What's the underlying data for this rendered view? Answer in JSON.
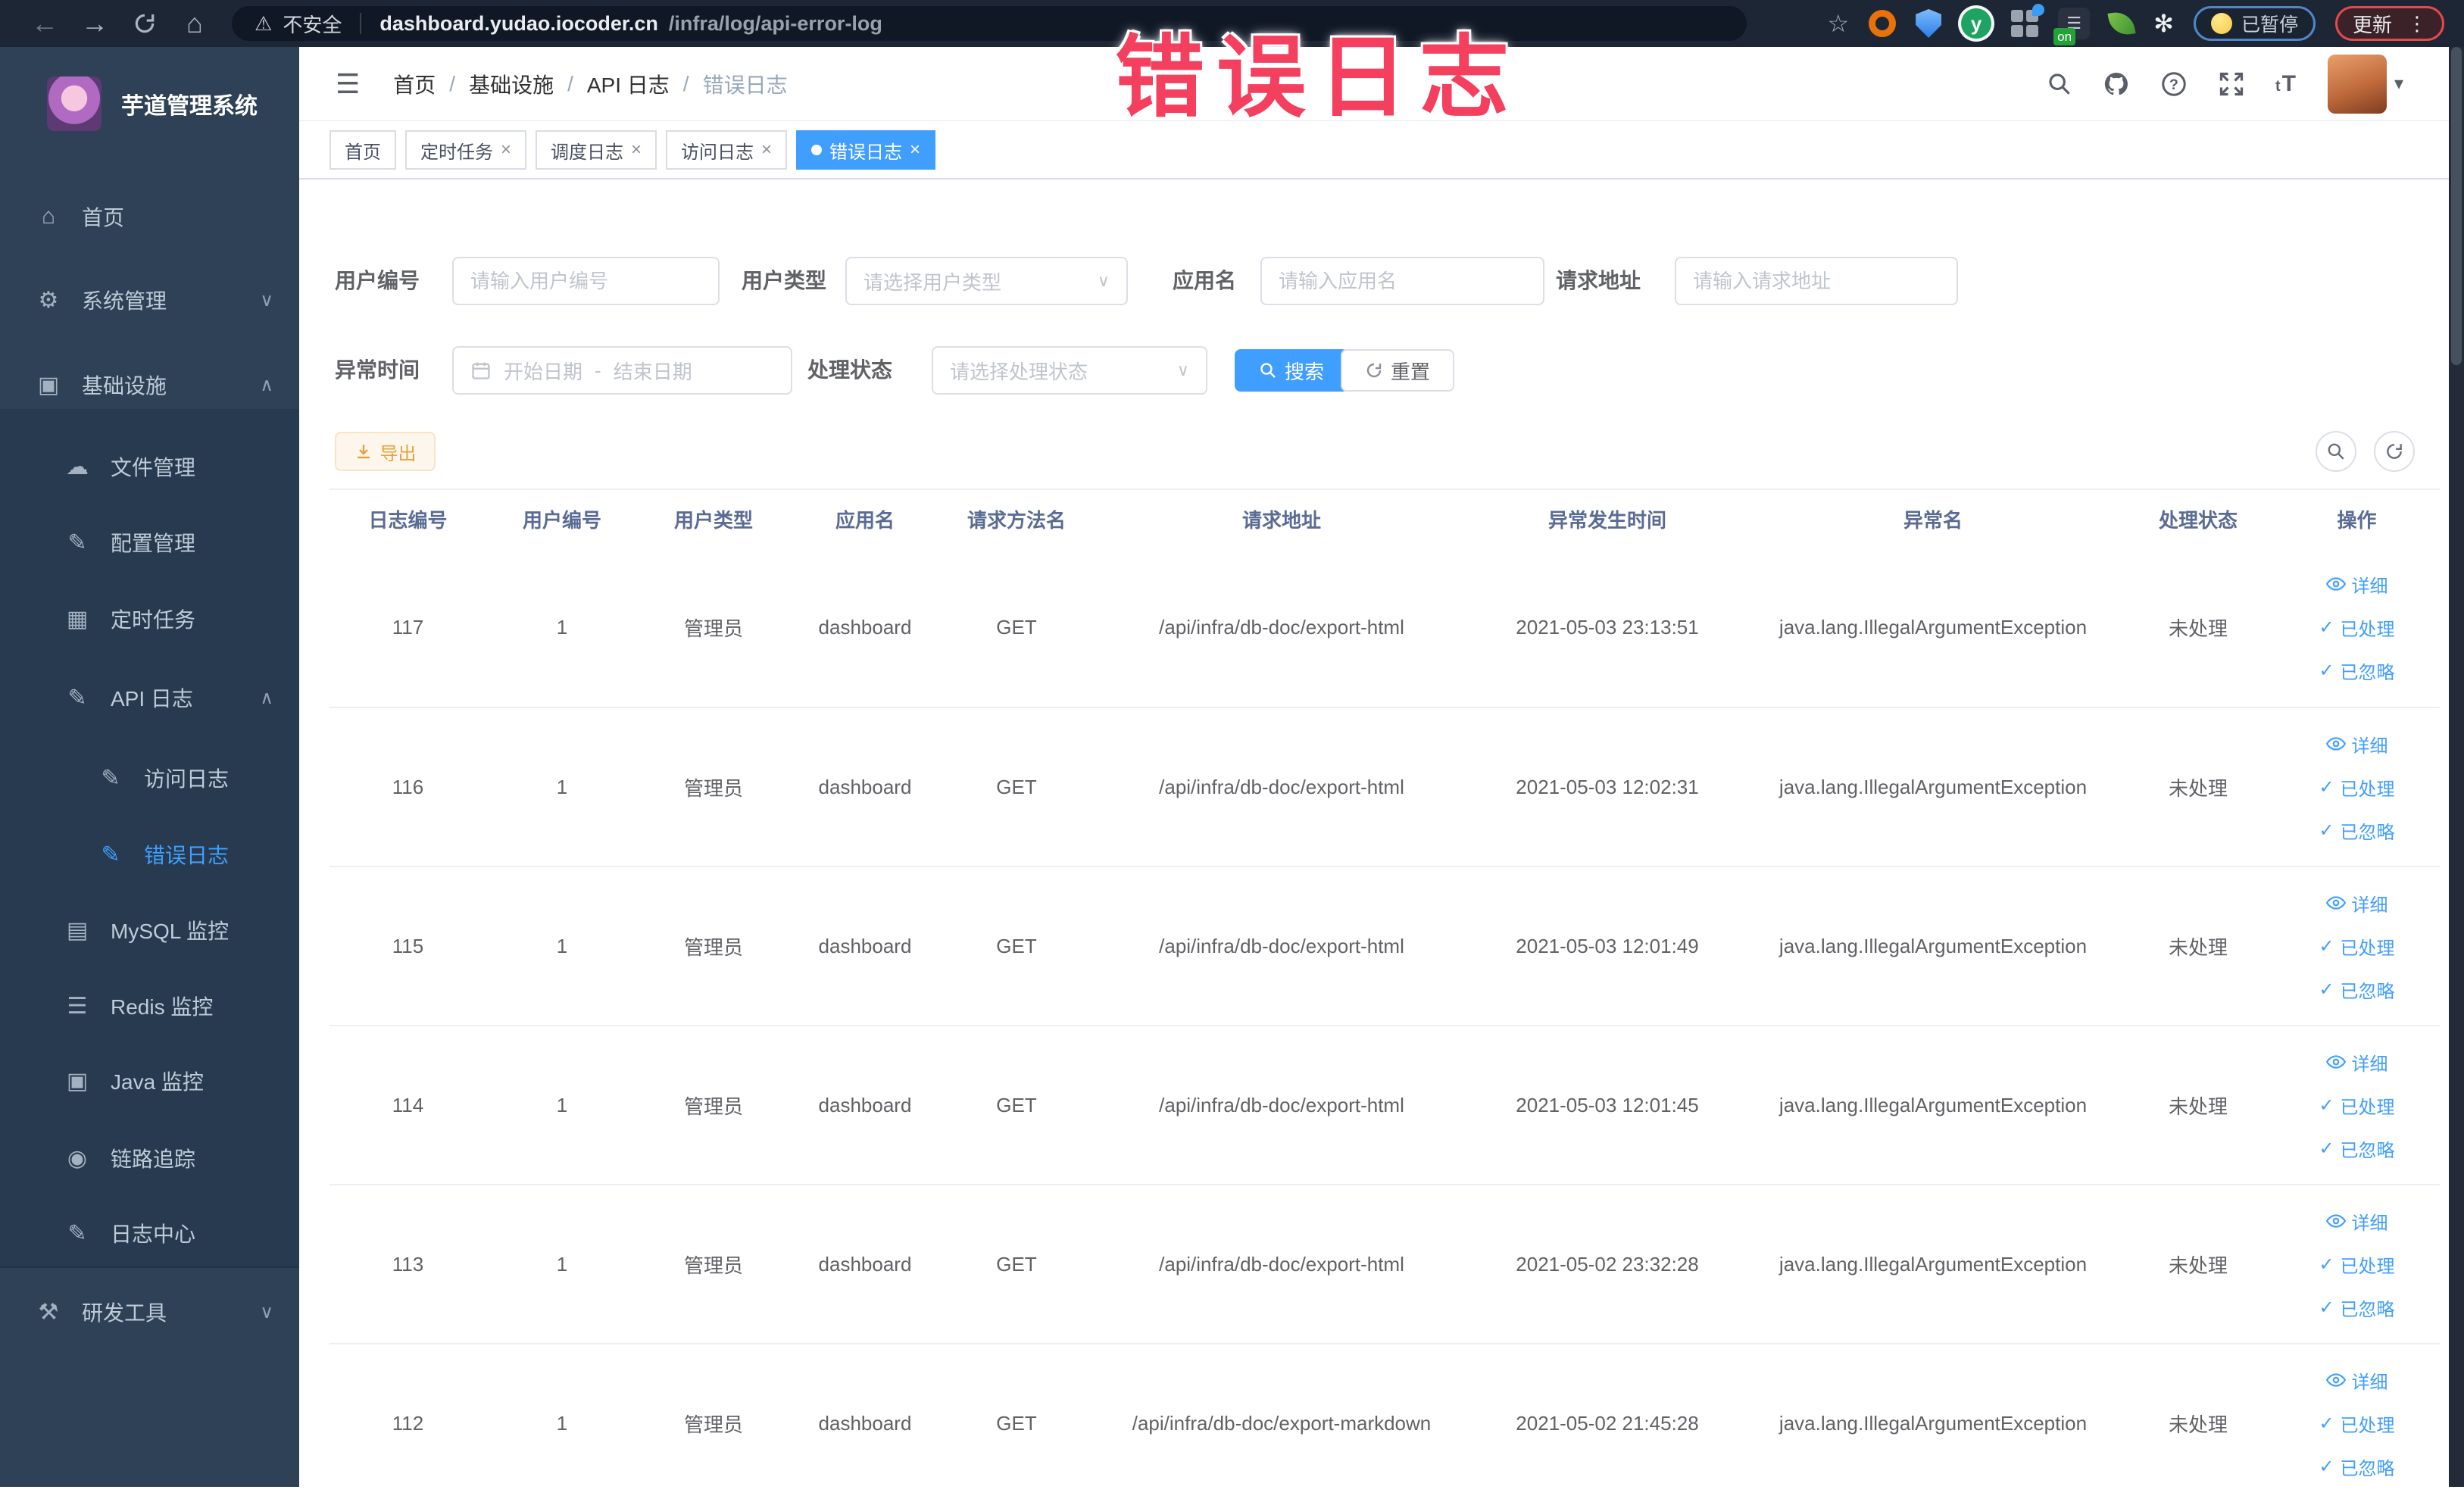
{
  "colors": {
    "primary": "#409eff",
    "warning": "#e6a23c",
    "annotation": "#f43f5e",
    "sidebar_bg": "#2e4156"
  },
  "icons": {
    "back": "←",
    "forward": "→",
    "home": "⌂",
    "menu_fold": "☰",
    "star": "☆",
    "warning": "⚠",
    "kebab": "⋮",
    "caret_down": "▾",
    "chevron_down": "∨",
    "chevron_up": "∧",
    "dot_dash": "-",
    "close": "×",
    "check": "✓",
    "puzzle": "✻",
    "lines": "☰",
    "font_size": "tT"
  },
  "browser": {
    "security": "不安全",
    "host": "dashboard.yudao.iocoder.cn",
    "path": "/infra/log/api-error-log",
    "on_badge": "on",
    "paused": "已暂停",
    "update": "更新"
  },
  "annotation": {
    "text": "错误日志"
  },
  "sidebar": {
    "title": "芋道管理系统",
    "items": [
      {
        "label": "首页",
        "icon": "⌂"
      },
      {
        "label": "系统管理",
        "icon": "⚙"
      },
      {
        "label": "基础设施",
        "icon": "▣"
      },
      {
        "label": "文件管理",
        "icon": "☁"
      },
      {
        "label": "配置管理",
        "icon": "✎"
      },
      {
        "label": "定时任务",
        "icon": "▦"
      },
      {
        "label": "API 日志",
        "icon": "✎"
      },
      {
        "label": "访问日志",
        "icon": "✎"
      },
      {
        "label": "错误日志",
        "icon": "✎"
      },
      {
        "label": "MySQL 监控",
        "icon": "▤"
      },
      {
        "label": "Redis 监控",
        "icon": "☰"
      },
      {
        "label": "Java 监控",
        "icon": "▣"
      },
      {
        "label": "链路追踪",
        "icon": "◉"
      },
      {
        "label": "日志中心",
        "icon": "✎"
      },
      {
        "label": "研发工具",
        "icon": "⚒"
      }
    ]
  },
  "breadcrumb": [
    "首页",
    "基础设施",
    "API 日志",
    "错误日志"
  ],
  "tags": [
    "首页",
    "定时任务",
    "调度日志",
    "访问日志",
    "错误日志"
  ],
  "filters": {
    "user_id_label": "用户编号",
    "user_id_placeholder": "请输入用户编号",
    "user_type_label": "用户类型",
    "user_type_placeholder": "请选择用户类型",
    "app_name_label": "应用名",
    "app_name_placeholder": "请输入应用名",
    "request_url_label": "请求地址",
    "request_url_placeholder": "请输入请求地址",
    "exception_time_label": "异常时间",
    "start_date_placeholder": "开始日期",
    "end_date_placeholder": "结束日期",
    "process_status_label": "处理状态",
    "process_status_placeholder": "请选择处理状态",
    "search_label": "搜索",
    "reset_label": "重置"
  },
  "toolbar": {
    "export": "导出"
  },
  "table": {
    "columns": [
      "日志编号",
      "用户编号",
      "用户类型",
      "应用名",
      "请求方法名",
      "请求地址",
      "异常发生时间",
      "异常名",
      "处理状态",
      "操作"
    ],
    "actions": {
      "detail": "详细",
      "processed": "已处理",
      "ignored": "已忽略"
    },
    "rows": [
      {
        "id": "117",
        "user_id": "1",
        "user_type": "管理员",
        "app": "dashboard",
        "method": "GET",
        "url": "/api/infra/db-doc/export-html",
        "time": "2021-05-03 23:13:51",
        "exception": "java.lang.IllegalArgumentException",
        "status": "未处理"
      },
      {
        "id": "116",
        "user_id": "1",
        "user_type": "管理员",
        "app": "dashboard",
        "method": "GET",
        "url": "/api/infra/db-doc/export-html",
        "time": "2021-05-03 12:02:31",
        "exception": "java.lang.IllegalArgumentException",
        "status": "未处理"
      },
      {
        "id": "115",
        "user_id": "1",
        "user_type": "管理员",
        "app": "dashboard",
        "method": "GET",
        "url": "/api/infra/db-doc/export-html",
        "time": "2021-05-03 12:01:49",
        "exception": "java.lang.IllegalArgumentException",
        "status": "未处理"
      },
      {
        "id": "114",
        "user_id": "1",
        "user_type": "管理员",
        "app": "dashboard",
        "method": "GET",
        "url": "/api/infra/db-doc/export-html",
        "time": "2021-05-03 12:01:45",
        "exception": "java.lang.IllegalArgumentException",
        "status": "未处理"
      },
      {
        "id": "113",
        "user_id": "1",
        "user_type": "管理员",
        "app": "dashboard",
        "method": "GET",
        "url": "/api/infra/db-doc/export-html",
        "time": "2021-05-02 23:32:28",
        "exception": "java.lang.IllegalArgumentException",
        "status": "未处理"
      },
      {
        "id": "112",
        "user_id": "1",
        "user_type": "管理员",
        "app": "dashboard",
        "method": "GET",
        "url": "/api/infra/db-doc/export-markdown",
        "time": "2021-05-02 21:45:28",
        "exception": "java.lang.IllegalArgumentException",
        "status": "未处理"
      }
    ]
  }
}
